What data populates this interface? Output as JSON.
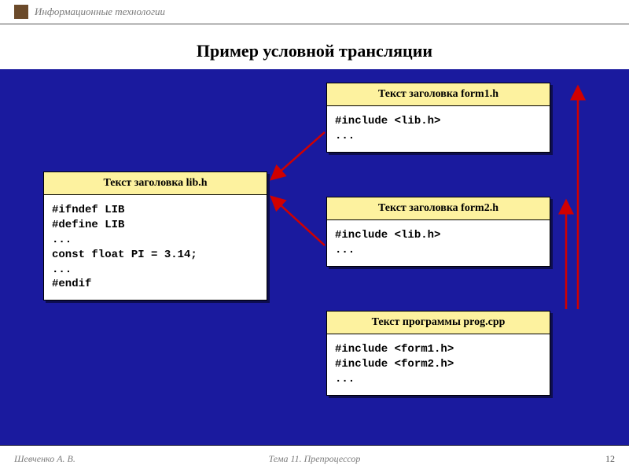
{
  "header": {
    "subject": "Информационные технологии"
  },
  "title": "Пример условной трансляции",
  "boxes": {
    "lib": {
      "header": "Текст заголовка lib.h",
      "code": "#ifndef LIB\n#define LIB\n...\nconst float PI = 3.14;\n...\n#endif"
    },
    "form1": {
      "header": "Текст заголовка form1.h",
      "code": "#include <lib.h>\n..."
    },
    "form2": {
      "header": "Текст заголовка form2.h",
      "code": "#include <lib.h>\n..."
    },
    "prog": {
      "header": "Текст программы prog.cpp",
      "code": "#include <form1.h>\n#include <form2.h>\n..."
    }
  },
  "footer": {
    "author": "Шевченко А. В.",
    "topic": "Тема 11. Препроцессор",
    "page": "12"
  },
  "colors": {
    "slide_bg": "#1a1a9e",
    "box_head": "#fdf29f",
    "arrow": "#d00000"
  }
}
